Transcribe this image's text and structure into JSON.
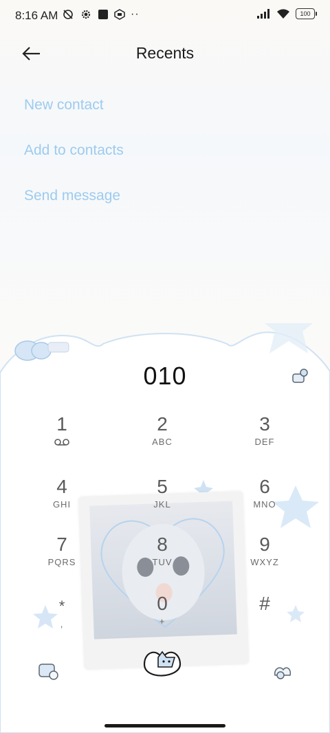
{
  "status": {
    "time": "8:16 AM",
    "battery": "100",
    "icons": [
      "alarm-off-icon",
      "settings-icon",
      "square-icon",
      "nfc-icon",
      "more-dots-icon"
    ]
  },
  "header": {
    "title": "Recents"
  },
  "actions": [
    {
      "label": "New contact"
    },
    {
      "label": "Add to contacts"
    },
    {
      "label": "Send message"
    }
  ],
  "dialer": {
    "number": "010",
    "keys": [
      {
        "digit": "1",
        "letters": ""
      },
      {
        "digit": "2",
        "letters": "ABC"
      },
      {
        "digit": "3",
        "letters": "DEF"
      },
      {
        "digit": "4",
        "letters": "GHI"
      },
      {
        "digit": "5",
        "letters": "JKL"
      },
      {
        "digit": "6",
        "letters": "MNO"
      },
      {
        "digit": "7",
        "letters": "PQRS"
      },
      {
        "digit": "8",
        "letters": "TUV"
      },
      {
        "digit": "9",
        "letters": "WXYZ"
      },
      {
        "digit": "*",
        "letters": ","
      },
      {
        "digit": "0",
        "letters": "+"
      },
      {
        "digit": "#",
        "letters": ""
      }
    ]
  },
  "colors": {
    "accent": "#9dcbef",
    "text": "#1c1c1c",
    "keys": "#5a5a5a"
  }
}
